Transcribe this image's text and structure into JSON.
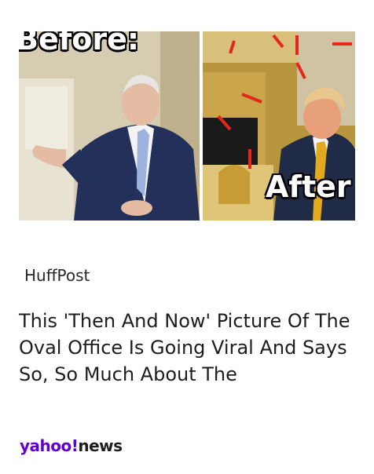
{
  "article": {
    "image": {
      "before_label": "Before:",
      "after_label": "After"
    },
    "source": "HuffPost",
    "headline": "This 'Then And Now' Picture Of The Oval Office Is Going Viral And Says So, So Much About The"
  },
  "footer": {
    "brand_yahoo": "yahoo!",
    "brand_news": "news"
  },
  "colors": {
    "brand_purple": "#6001d2",
    "arrow_red": "#e4261b",
    "text_dark": "#1d1d1f"
  }
}
